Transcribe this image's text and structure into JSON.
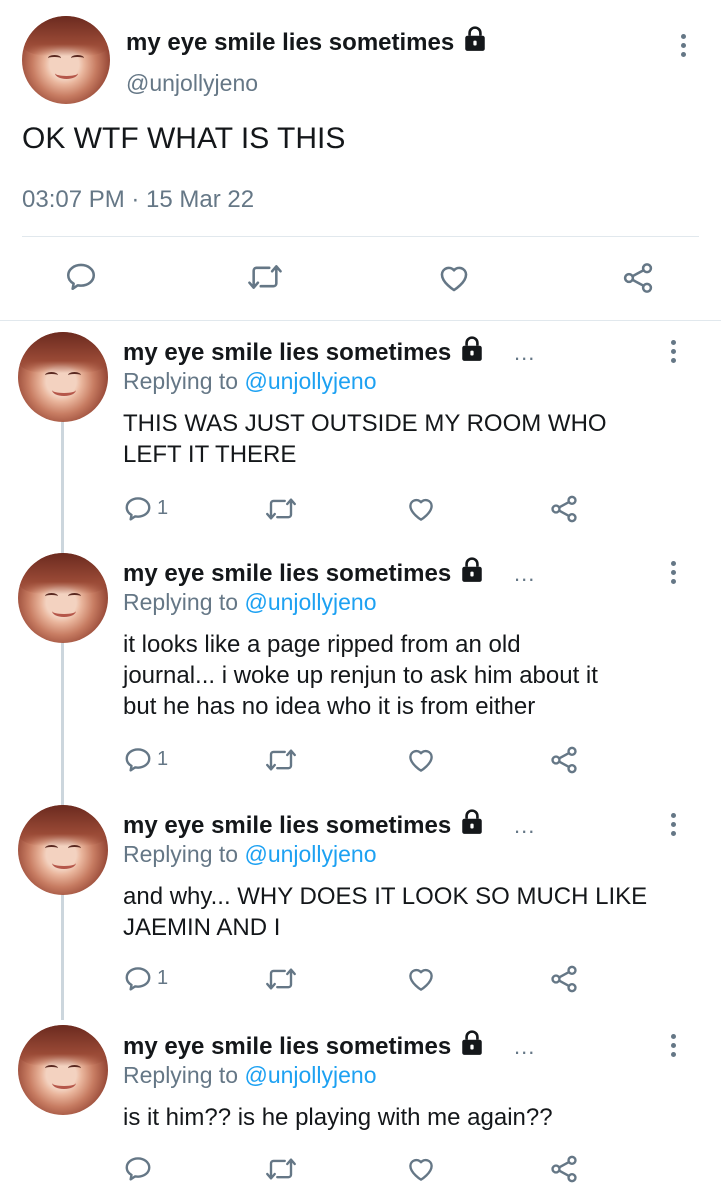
{
  "main_tweet": {
    "display_name": "my eye smile lies sometimes",
    "handle": "@unjollyjeno",
    "text": "OK WTF WHAT IS THIS",
    "timestamp": "03:07 PM · 15 Mar 22"
  },
  "replies": [
    {
      "display_name": "my eye smile lies sometimes",
      "ellipsis": "...",
      "replying_prefix": "Replying to",
      "replying_handle": "@unjollyjeno",
      "text_lines": [
        "THIS WAS JUST OUTSIDE MY ROOM WHO",
        "LEFT IT THERE"
      ],
      "reply_count": "1"
    },
    {
      "display_name": "my eye smile lies sometimes",
      "ellipsis": "...",
      "replying_prefix": "Replying to",
      "replying_handle": "@unjollyjeno",
      "text_lines": [
        "it looks like a page ripped from an old",
        "journal... i woke up renjun to ask him about it",
        "but he has no idea who it is from either"
      ],
      "reply_count": "1"
    },
    {
      "display_name": "my eye smile lies sometimes",
      "ellipsis": "...",
      "replying_prefix": "Replying to",
      "replying_handle": "@unjollyjeno",
      "text_lines": [
        "and why... WHY DOES IT LOOK SO MUCH LIKE",
        "JAEMIN AND I"
      ],
      "reply_count": "1"
    },
    {
      "display_name": "my eye smile lies sometimes",
      "ellipsis": "...",
      "replying_prefix": "Replying to",
      "replying_handle": "@unjollyjeno",
      "text_lines": [
        "is it him?? is he playing with me again??"
      ],
      "reply_count": ""
    }
  ],
  "icons": [
    "reply-icon",
    "retweet-icon",
    "like-icon",
    "share-icon",
    "lock-icon",
    "more-options-icon"
  ],
  "colors": {
    "accent": "#1da1f2",
    "secondary_text": "#657786",
    "divider": "#e1e8ed",
    "thread_line": "#ccd6dd"
  }
}
